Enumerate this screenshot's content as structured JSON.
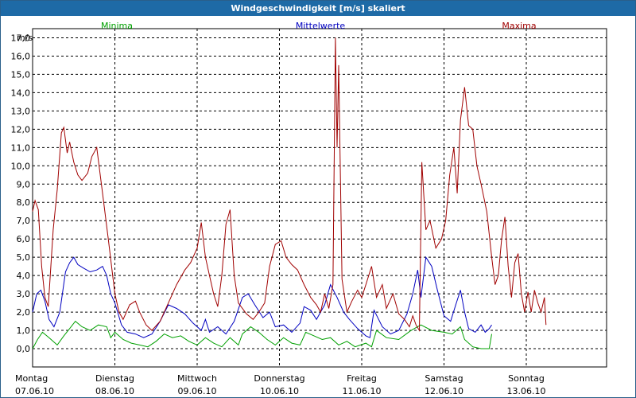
{
  "window": {
    "title": "Windgeschwindigkeit [m/s] skaliert"
  },
  "chart_data": {
    "type": "line",
    "title": "Windgeschwindigkeit [m/s] skaliert",
    "ylabel": "m/s",
    "ylim": [
      -1.0,
      17.5
    ],
    "yticks": [
      "0,0",
      "1,0",
      "2,0",
      "3,0",
      "4,0",
      "5,0",
      "6,0",
      "7,0",
      "8,0",
      "9,0",
      "10,0",
      "11,0",
      "12,0",
      "13,0",
      "14,0",
      "15,0",
      "16,0",
      "17,0"
    ],
    "grid": true,
    "legend_position": "top",
    "x_tick_labels": [
      {
        "day": "Montag",
        "date": "07.06.10"
      },
      {
        "day": "Dienstag",
        "date": "08.06.10"
      },
      {
        "day": "Mittwoch",
        "date": "09.06.10"
      },
      {
        "day": "Donnerstag",
        "date": "10.06.10"
      },
      {
        "day": "Freitag",
        "date": "11.06.10"
      },
      {
        "day": "Samstag",
        "date": "12.06.10"
      },
      {
        "day": "Sonntag",
        "date": "13.06.10"
      }
    ],
    "x_range_days": [
      0,
      7
    ],
    "series": [
      {
        "name": "Minima",
        "color": "#00a000",
        "points": [
          [
            0,
            0.0
          ],
          [
            0.06,
            0.5
          ],
          [
            0.12,
            0.9
          ],
          [
            0.2,
            0.6
          ],
          [
            0.3,
            0.2
          ],
          [
            0.38,
            0.7
          ],
          [
            0.45,
            1.1
          ],
          [
            0.52,
            1.5
          ],
          [
            0.6,
            1.2
          ],
          [
            0.7,
            1.0
          ],
          [
            0.8,
            1.3
          ],
          [
            0.9,
            1.2
          ],
          [
            0.95,
            0.6
          ],
          [
            1.0,
            0.9
          ],
          [
            1.1,
            0.5
          ],
          [
            1.2,
            0.3
          ],
          [
            1.3,
            0.2
          ],
          [
            1.4,
            0.1
          ],
          [
            1.5,
            0.4
          ],
          [
            1.6,
            0.8
          ],
          [
            1.7,
            0.6
          ],
          [
            1.8,
            0.7
          ],
          [
            1.9,
            0.4
          ],
          [
            2.0,
            0.2
          ],
          [
            2.1,
            0.6
          ],
          [
            2.2,
            0.3
          ],
          [
            2.3,
            0.1
          ],
          [
            2.4,
            0.6
          ],
          [
            2.5,
            0.2
          ],
          [
            2.55,
            0.8
          ],
          [
            2.65,
            1.2
          ],
          [
            2.75,
            0.9
          ],
          [
            2.85,
            0.5
          ],
          [
            2.95,
            0.2
          ],
          [
            3.05,
            0.6
          ],
          [
            3.15,
            0.3
          ],
          [
            3.25,
            0.2
          ],
          [
            3.32,
            0.9
          ],
          [
            3.42,
            0.7
          ],
          [
            3.52,
            0.5
          ],
          [
            3.62,
            0.6
          ],
          [
            3.72,
            0.2
          ],
          [
            3.82,
            0.4
          ],
          [
            3.92,
            0.1
          ],
          [
            4.05,
            0.3
          ],
          [
            4.12,
            0.1
          ],
          [
            4.18,
            1.0
          ],
          [
            4.3,
            0.6
          ],
          [
            4.45,
            0.5
          ],
          [
            4.6,
            1.0
          ],
          [
            4.72,
            1.3
          ],
          [
            4.85,
            1.0
          ],
          [
            5.0,
            0.9
          ],
          [
            5.1,
            0.8
          ],
          [
            5.2,
            1.2
          ],
          [
            5.25,
            0.5
          ],
          [
            5.35,
            0.1
          ],
          [
            5.45,
            0.0
          ],
          [
            5.55,
            0.0
          ],
          [
            5.58,
            0.8
          ]
        ]
      },
      {
        "name": "Mittelwerte",
        "color": "#0000c0",
        "points": [
          [
            0,
            2.0
          ],
          [
            0.05,
            3.0
          ],
          [
            0.1,
            3.2
          ],
          [
            0.15,
            2.6
          ],
          [
            0.2,
            1.6
          ],
          [
            0.26,
            1.2
          ],
          [
            0.33,
            2.0
          ],
          [
            0.4,
            4.2
          ],
          [
            0.45,
            4.7
          ],
          [
            0.5,
            5.0
          ],
          [
            0.55,
            4.6
          ],
          [
            0.62,
            4.4
          ],
          [
            0.7,
            4.2
          ],
          [
            0.78,
            4.3
          ],
          [
            0.85,
            4.5
          ],
          [
            0.9,
            4.0
          ],
          [
            0.95,
            3.0
          ],
          [
            1.0,
            2.5
          ],
          [
            1.08,
            1.3
          ],
          [
            1.15,
            0.9
          ],
          [
            1.25,
            0.8
          ],
          [
            1.35,
            0.6
          ],
          [
            1.45,
            0.8
          ],
          [
            1.55,
            1.5
          ],
          [
            1.65,
            2.4
          ],
          [
            1.75,
            2.2
          ],
          [
            1.85,
            1.9
          ],
          [
            1.95,
            1.4
          ],
          [
            2.05,
            1.0
          ],
          [
            2.1,
            1.6
          ],
          [
            2.15,
            0.9
          ],
          [
            2.25,
            1.2
          ],
          [
            2.35,
            0.8
          ],
          [
            2.45,
            1.5
          ],
          [
            2.55,
            2.8
          ],
          [
            2.62,
            3.0
          ],
          [
            2.7,
            2.4
          ],
          [
            2.8,
            1.7
          ],
          [
            2.88,
            2.0
          ],
          [
            2.95,
            1.2
          ],
          [
            3.05,
            1.3
          ],
          [
            3.15,
            0.9
          ],
          [
            3.25,
            1.4
          ],
          [
            3.3,
            2.3
          ],
          [
            3.38,
            2.1
          ],
          [
            3.45,
            1.6
          ],
          [
            3.55,
            2.4
          ],
          [
            3.62,
            3.5
          ],
          [
            3.7,
            2.8
          ],
          [
            3.78,
            2.0
          ],
          [
            3.85,
            1.6
          ],
          [
            3.95,
            1.1
          ],
          [
            4.05,
            0.7
          ],
          [
            4.1,
            0.6
          ],
          [
            4.15,
            2.1
          ],
          [
            4.25,
            1.2
          ],
          [
            4.35,
            0.8
          ],
          [
            4.45,
            1.0
          ],
          [
            4.55,
            1.9
          ],
          [
            4.62,
            3.0
          ],
          [
            4.68,
            4.3
          ],
          [
            4.72,
            2.8
          ],
          [
            4.78,
            5.0
          ],
          [
            4.85,
            4.5
          ],
          [
            4.92,
            3.2
          ],
          [
            5.0,
            1.8
          ],
          [
            5.08,
            1.5
          ],
          [
            5.15,
            2.5
          ],
          [
            5.2,
            3.2
          ],
          [
            5.25,
            2.0
          ],
          [
            5.3,
            1.1
          ],
          [
            5.38,
            0.9
          ],
          [
            5.45,
            1.3
          ],
          [
            5.5,
            0.9
          ],
          [
            5.55,
            1.1
          ],
          [
            5.58,
            1.3
          ]
        ]
      },
      {
        "name": "Maxima",
        "color": "#a00000",
        "points": [
          [
            0,
            7.5
          ],
          [
            0.03,
            8.1
          ],
          [
            0.07,
            7.6
          ],
          [
            0.11,
            4.5
          ],
          [
            0.15,
            2.8
          ],
          [
            0.19,
            2.3
          ],
          [
            0.25,
            6.5
          ],
          [
            0.3,
            8.7
          ],
          [
            0.35,
            11.8
          ],
          [
            0.38,
            12.1
          ],
          [
            0.42,
            10.7
          ],
          [
            0.45,
            11.3
          ],
          [
            0.5,
            10.2
          ],
          [
            0.55,
            9.5
          ],
          [
            0.6,
            9.2
          ],
          [
            0.67,
            9.6
          ],
          [
            0.72,
            10.5
          ],
          [
            0.78,
            11.0
          ],
          [
            0.85,
            8.5
          ],
          [
            0.92,
            6.0
          ],
          [
            1.0,
            3.0
          ],
          [
            1.05,
            2.0
          ],
          [
            1.1,
            1.6
          ],
          [
            1.18,
            2.4
          ],
          [
            1.25,
            2.6
          ],
          [
            1.3,
            2.0
          ],
          [
            1.38,
            1.3
          ],
          [
            1.45,
            1.0
          ],
          [
            1.55,
            1.5
          ],
          [
            1.65,
            2.5
          ],
          [
            1.75,
            3.5
          ],
          [
            1.85,
            4.3
          ],
          [
            1.92,
            4.7
          ],
          [
            2.0,
            5.5
          ],
          [
            2.05,
            6.9
          ],
          [
            2.1,
            5.0
          ],
          [
            2.15,
            4.0
          ],
          [
            2.2,
            3.0
          ],
          [
            2.25,
            2.3
          ],
          [
            2.3,
            4.0
          ],
          [
            2.35,
            6.8
          ],
          [
            2.4,
            7.6
          ],
          [
            2.45,
            4.0
          ],
          [
            2.5,
            2.5
          ],
          [
            2.6,
            1.9
          ],
          [
            2.68,
            1.6
          ],
          [
            2.75,
            2.0
          ],
          [
            2.82,
            2.5
          ],
          [
            2.88,
            4.5
          ],
          [
            2.95,
            5.7
          ],
          [
            3.02,
            5.9
          ],
          [
            3.08,
            5.0
          ],
          [
            3.15,
            4.6
          ],
          [
            3.22,
            4.3
          ],
          [
            3.3,
            3.5
          ],
          [
            3.38,
            2.8
          ],
          [
            3.45,
            2.4
          ],
          [
            3.5,
            2.0
          ],
          [
            3.55,
            3.0
          ],
          [
            3.6,
            2.2
          ],
          [
            3.65,
            3.5
          ],
          [
            3.68,
            17.0
          ],
          [
            3.7,
            11.0
          ],
          [
            3.72,
            15.5
          ],
          [
            3.76,
            3.8
          ],
          [
            3.82,
            2.0
          ],
          [
            3.88,
            2.6
          ],
          [
            3.95,
            3.2
          ],
          [
            4.0,
            2.8
          ],
          [
            4.05,
            3.5
          ],
          [
            4.12,
            4.5
          ],
          [
            4.18,
            2.8
          ],
          [
            4.25,
            3.5
          ],
          [
            4.3,
            2.2
          ],
          [
            4.38,
            3.0
          ],
          [
            4.45,
            1.9
          ],
          [
            4.52,
            1.6
          ],
          [
            4.58,
            1.2
          ],
          [
            4.62,
            1.8
          ],
          [
            4.66,
            1.3
          ],
          [
            4.7,
            1.0
          ],
          [
            4.73,
            10.2
          ],
          [
            4.78,
            6.5
          ],
          [
            4.83,
            7.0
          ],
          [
            4.9,
            5.5
          ],
          [
            4.97,
            6.0
          ],
          [
            5.02,
            7.0
          ],
          [
            5.07,
            9.5
          ],
          [
            5.12,
            11.0
          ],
          [
            5.16,
            8.5
          ],
          [
            5.2,
            12.5
          ],
          [
            5.25,
            14.3
          ],
          [
            5.3,
            12.2
          ],
          [
            5.35,
            12.0
          ],
          [
            5.4,
            10.0
          ],
          [
            5.45,
            9.0
          ],
          [
            5.52,
            7.5
          ],
          [
            5.58,
            5.0
          ],
          [
            5.62,
            3.5
          ],
          [
            5.66,
            4.0
          ],
          [
            5.7,
            6.0
          ],
          [
            5.74,
            7.2
          ],
          [
            5.78,
            4.5
          ],
          [
            5.82,
            2.8
          ],
          [
            5.86,
            4.7
          ],
          [
            5.9,
            5.2
          ],
          [
            5.94,
            3.0
          ],
          [
            5.98,
            2.0
          ],
          [
            6.02,
            3.1
          ],
          [
            6.06,
            2.0
          ],
          [
            6.1,
            3.2
          ],
          [
            6.14,
            2.5
          ],
          [
            6.18,
            2.0
          ],
          [
            6.22,
            2.8
          ],
          [
            6.24,
            1.3
          ]
        ]
      }
    ]
  }
}
